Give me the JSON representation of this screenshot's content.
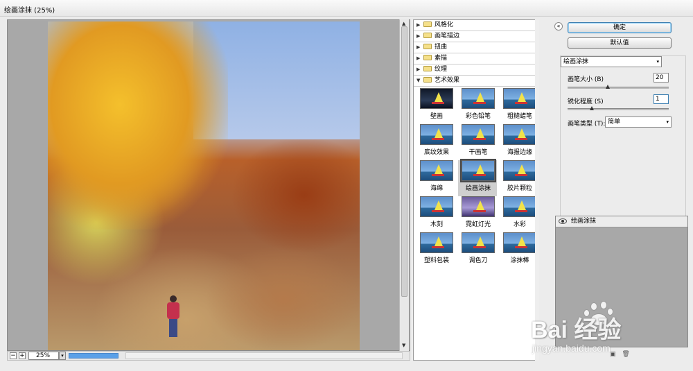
{
  "window": {
    "title": "绘画涂抹 (25%)"
  },
  "preview": {
    "zoom_value": "25%",
    "zoom_minus": "−",
    "zoom_plus": "+",
    "zoom_dropdown": "▾",
    "render_progress": 1.0
  },
  "gallery": {
    "categories": [
      {
        "label": "风格化",
        "expanded": false
      },
      {
        "label": "画笔描边",
        "expanded": false
      },
      {
        "label": "扭曲",
        "expanded": false
      },
      {
        "label": "素描",
        "expanded": false
      },
      {
        "label": "纹理",
        "expanded": false
      },
      {
        "label": "艺术效果",
        "expanded": true
      }
    ],
    "collapsed_arrow": "▶",
    "expanded_arrow": "▼",
    "filters": [
      {
        "label": "壁画",
        "style": "dark"
      },
      {
        "label": "彩色铅笔",
        "style": "normal"
      },
      {
        "label": "粗糙蜡笔",
        "style": "normal"
      },
      {
        "label": "底纹效果",
        "style": "normal"
      },
      {
        "label": "干画笔",
        "style": "normal"
      },
      {
        "label": "海报边缘",
        "style": "normal"
      },
      {
        "label": "海绵",
        "style": "normal"
      },
      {
        "label": "绘画涂抹",
        "style": "normal",
        "selected": true
      },
      {
        "label": "胶片颗粒",
        "style": "normal"
      },
      {
        "label": "木刻",
        "style": "normal"
      },
      {
        "label": "霓虹灯光",
        "style": "purple"
      },
      {
        "label": "水彩",
        "style": "normal"
      },
      {
        "label": "塑料包装",
        "style": "normal"
      },
      {
        "label": "调色刀",
        "style": "normal"
      },
      {
        "label": "涂抹棒",
        "style": "normal"
      }
    ]
  },
  "controls": {
    "collapse_icon": "«",
    "ok_label": "确定",
    "default_label": "默认值",
    "filter_select": "绘画涂抹",
    "brush_size_label": "画笔大小 (B)",
    "brush_size_value": "20",
    "sharpness_label": "锐化程度 (S)",
    "sharpness_value": "1",
    "brush_type_label": "画笔类型 (T):",
    "brush_type_value": "简单",
    "dropdown_arrow": "▾",
    "brush_size_fraction": 0.4,
    "sharpness_fraction": 0.025
  },
  "layers": {
    "items": [
      {
        "label": "绘画涂抹"
      }
    ],
    "new_icon": "▣",
    "delete_icon": "🗑"
  },
  "watermark": {
    "text": "Bai  经验",
    "url": "jingyan.baidu.com"
  }
}
